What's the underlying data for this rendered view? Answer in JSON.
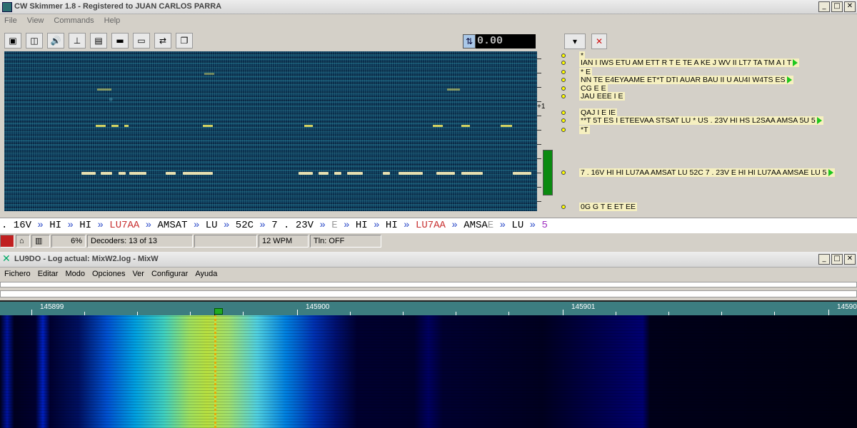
{
  "skimmer": {
    "title": "CW Skimmer 1.8 - Registered to JUAN CARLOS PARRA",
    "menu": [
      "File",
      "View",
      "Commands",
      "Help"
    ],
    "freq_offset": "0.00",
    "scale_label": "+1",
    "calls": [
      {
        "text": "*"
      },
      {
        "text": "IAN I IWS ETU AM ETT R T E TE A KE J WV II LT7 TA TM A I T",
        "arrow": true
      },
      {
        "text": "* E"
      },
      {
        "text": "NN TE E4EYAAME ET*T DTI AUAR BAU II U AU4I W4TS ES",
        "arrow": true
      },
      {
        "text": "CG E E"
      },
      {
        "text": "JAU EEE I E"
      },
      {
        "text": "QAJ I E IE"
      },
      {
        "text": "**T 5T ES I ETEEVAA STSAT LU * US . 23V HI HS L2SAA AMSA 5U 5",
        "arrow": true
      },
      {
        "text": "*T"
      },
      {
        "text": "7 . 16V HI HI LU7AA AMSAT LU 52C 7 . 23V E HI HI LU7AA AMSAE LU 5",
        "arrow": true
      },
      {
        "text": "0G G T E ET EE"
      }
    ],
    "decoder_line": [
      {
        "t": ". 16V",
        "c": ""
      },
      {
        "t": " » ",
        "c": "sep2"
      },
      {
        "t": "HI",
        "c": ""
      },
      {
        "t": " » ",
        "c": "sep2"
      },
      {
        "t": "HI",
        "c": ""
      },
      {
        "t": " » ",
        "c": "sep2"
      },
      {
        "t": "LU7AA",
        "c": "red"
      },
      {
        "t": " » ",
        "c": "sep2"
      },
      {
        "t": "AMSAT",
        "c": ""
      },
      {
        "t": " » ",
        "c": "sep2"
      },
      {
        "t": "LU",
        "c": ""
      },
      {
        "t": " » ",
        "c": "sep2"
      },
      {
        "t": "52C",
        "c": ""
      },
      {
        "t": " » ",
        "c": "sep2"
      },
      {
        "t": "7 . 23V",
        "c": ""
      },
      {
        "t": " » ",
        "c": "sep2"
      },
      {
        "t": "E",
        "c": "gray"
      },
      {
        "t": " » ",
        "c": "sep2"
      },
      {
        "t": "HI",
        "c": ""
      },
      {
        "t": " » ",
        "c": "sep2"
      },
      {
        "t": "HI",
        "c": ""
      },
      {
        "t": " » ",
        "c": "sep2"
      },
      {
        "t": "LU7AA",
        "c": "red"
      },
      {
        "t": " » ",
        "c": "sep2"
      },
      {
        "t": "AMSA",
        "c": ""
      },
      {
        "t": "E",
        "c": "gray"
      },
      {
        "t": " » ",
        "c": "sep2"
      },
      {
        "t": "LU",
        "c": ""
      },
      {
        "t": " » ",
        "c": "sep2"
      },
      {
        "t": "5",
        "c": "mag"
      }
    ],
    "status": {
      "cpu": "6%",
      "decoders": "Decoders: 13 of 13",
      "wpm": "12 WPM",
      "tln": "Tln: OFF"
    }
  },
  "mixw": {
    "title": "LU9DO - Log actual: MixW2.log - MixW",
    "menu": [
      "Fichero",
      "Editar",
      "Modo",
      "Opciones",
      "Ver",
      "Configurar",
      "Ayuda"
    ],
    "freq_labels": [
      "145899",
      "145900",
      "145901",
      "14590"
    ]
  },
  "colors": {
    "decoder_separator": "#2b4ac8",
    "callsign": "#c83030"
  }
}
